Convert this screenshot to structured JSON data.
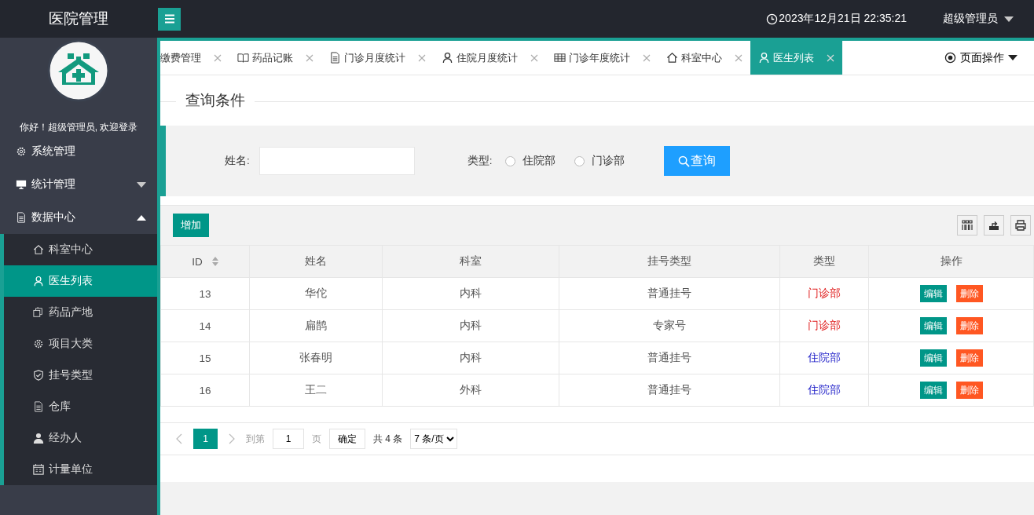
{
  "header": {
    "app_title": "医院管理",
    "datetime": "2023年12月21日 22:35:21",
    "user": "超级管理员"
  },
  "sidebar": {
    "greeting": "你好！超级管理员, 欢迎登录",
    "items": [
      {
        "label": "系统管理"
      },
      {
        "label": "统计管理",
        "expanded": false
      },
      {
        "label": "数据中心",
        "expanded": true,
        "children": [
          {
            "label": "科室中心",
            "selected": false
          },
          {
            "label": "医生列表",
            "selected": true
          },
          {
            "label": "药品产地",
            "selected": false
          },
          {
            "label": "项目大类",
            "selected": false
          },
          {
            "label": "挂号类型",
            "selected": false
          },
          {
            "label": "仓库",
            "selected": false
          },
          {
            "label": "经办人",
            "selected": false
          },
          {
            "label": "计量单位",
            "selected": false
          }
        ]
      }
    ]
  },
  "tabs": [
    {
      "label": "缴费管理",
      "selected": false
    },
    {
      "label": "药品记账",
      "selected": false
    },
    {
      "label": "门诊月度统计",
      "selected": false
    },
    {
      "label": "住院月度统计",
      "selected": false
    },
    {
      "label": "门诊年度统计",
      "selected": false
    },
    {
      "label": "科室中心",
      "selected": false
    },
    {
      "label": "医生列表",
      "selected": true
    }
  ],
  "page_actions": "页面操作",
  "query": {
    "legend": "查询条件",
    "name_label": "姓名:",
    "type_label": "类型:",
    "options": [
      {
        "label": "住院部",
        "selected": false
      },
      {
        "label": "门诊部",
        "selected": false
      }
    ],
    "search_button": "查询"
  },
  "table": {
    "add_button": "增加",
    "columns": [
      "ID",
      "姓名",
      "科室",
      "挂号类型",
      "类型",
      "操作"
    ],
    "rows": [
      {
        "id": "13",
        "name": "华佗",
        "department": "内科",
        "registration_type": "普通挂号",
        "type": "门诊部",
        "color": "#e02020",
        "actions": [
          "编辑",
          "删除"
        ]
      },
      {
        "id": "14",
        "name": "扁鹊",
        "department": "内科",
        "registration_type": "专家号",
        "type": "门诊部",
        "color": "#e02020",
        "actions": [
          "编辑",
          "删除"
        ]
      },
      {
        "id": "15",
        "name": "张春明",
        "department": "内科",
        "registration_type": "普通挂号",
        "type": "住院部",
        "color": "#1f1fc8",
        "actions": [
          "编辑",
          "删除"
        ]
      },
      {
        "id": "16",
        "name": "王二",
        "department": "外科",
        "registration_type": "普通挂号",
        "type": "住院部",
        "color": "#1f1fc8",
        "actions": [
          "编辑",
          "删除"
        ]
      }
    ]
  },
  "pagination": {
    "pages": [
      {
        "label": "1",
        "selected": true
      }
    ],
    "goto_label": "到第",
    "page_value": "1",
    "page_unit": "页",
    "confirm": "确定",
    "total": "共 4 条",
    "page_size": "7 条/页"
  }
}
